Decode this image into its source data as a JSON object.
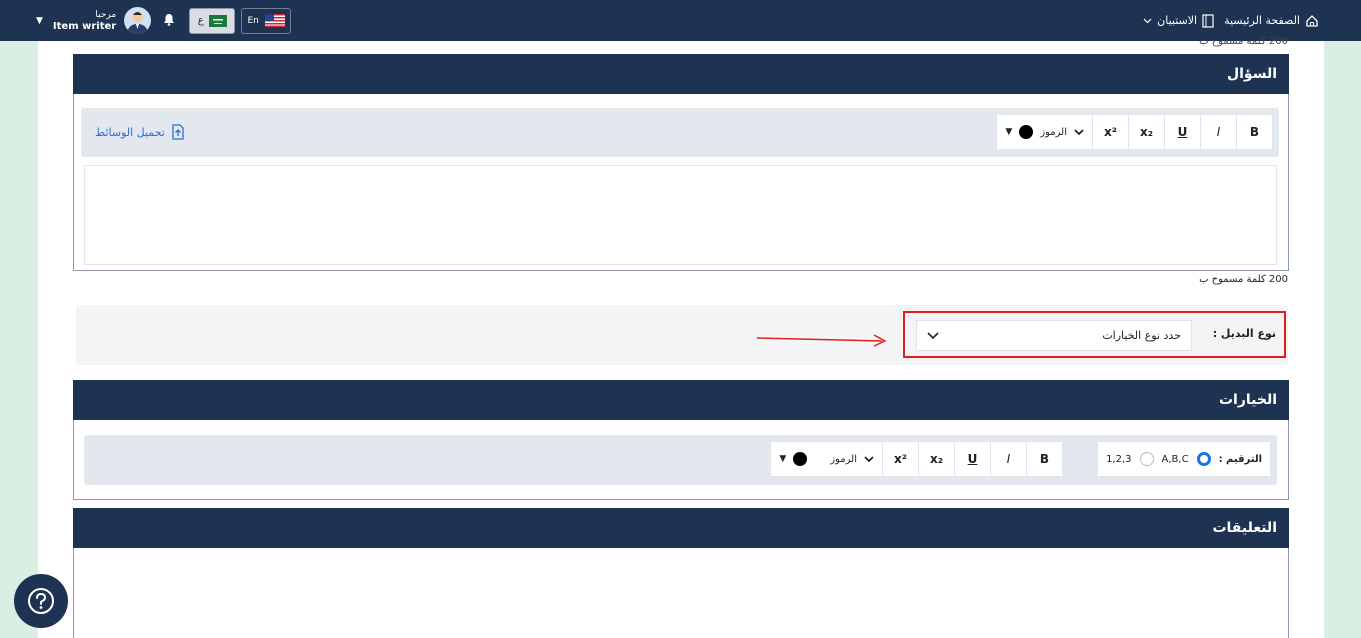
{
  "topbar": {
    "greeting": "مرحبا",
    "username": "Item writer",
    "lang_ar_label": "ع",
    "lang_en_label": "En",
    "home_label": "الصفحة الرئيسية",
    "survey_label": "الاستبيان"
  },
  "top_counter_text": "200 كلمة مسموح ب",
  "question": {
    "title": "السؤال",
    "toolbar": {
      "bold": "B",
      "italic": "I",
      "underline": "U",
      "subscript": "x₂",
      "superscript": "x²",
      "symbols_label": "الرموز"
    },
    "upload_label": "تحميل الوسائط",
    "counter_text": "200 كلمة مسموح ب"
  },
  "alternative": {
    "label": "نوع البديل :",
    "select_value": "حدد نوع الخيارات"
  },
  "choices": {
    "title": "الخيارات",
    "numbering_label": "الترقيم :",
    "options": [
      "A,B,C",
      "1,2,3"
    ],
    "selected": "A,B,C",
    "toolbar": {
      "bold": "B",
      "italic": "I",
      "underline": "U",
      "subscript": "x₂",
      "superscript": "x²",
      "symbols_label": "الرموز"
    }
  },
  "comments": {
    "title": "التعليقات"
  },
  "colors": {
    "navy": "#1e3252",
    "annotation_red": "#e01e1e",
    "link_blue": "#2f6fcf"
  }
}
